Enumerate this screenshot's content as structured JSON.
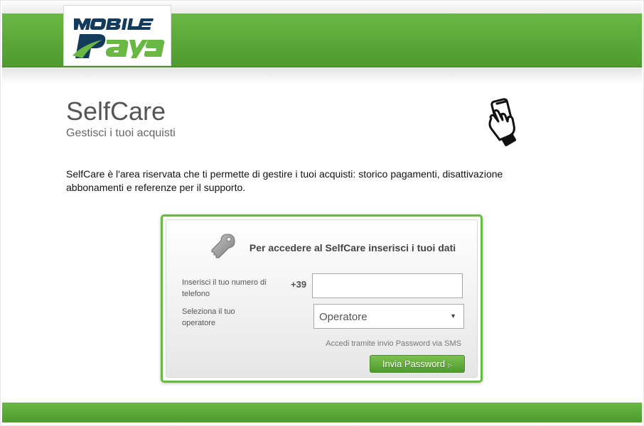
{
  "header": {
    "logo_alt_icon": "mobile-pay-logo",
    "brand_color": "#5aa838"
  },
  "intro": {
    "title": "SelfCare",
    "subtitle": "Gestisci i tuoi acquisti",
    "description": "SelfCare è l'area riservata che ti permette di gestire i tuoi acquisti: storico pagamenti, disattivazione abbonamenti e referenze per il supporto.",
    "side_icon": "hand-holding-phone-icon"
  },
  "login": {
    "key_icon": "key-icon",
    "heading": "Per accedere al  SelfCare inserisci i tuoi dati",
    "phone_label": "Inserisci il tuo numero di telefono",
    "phone_prefix": "+39",
    "phone_value": "",
    "operator_label": "Seleziona il tuo operatore",
    "operator_selected": "Operatore",
    "sms_note": "Accedi tramite invio Password via SMS",
    "send_button": "Invia Password"
  }
}
